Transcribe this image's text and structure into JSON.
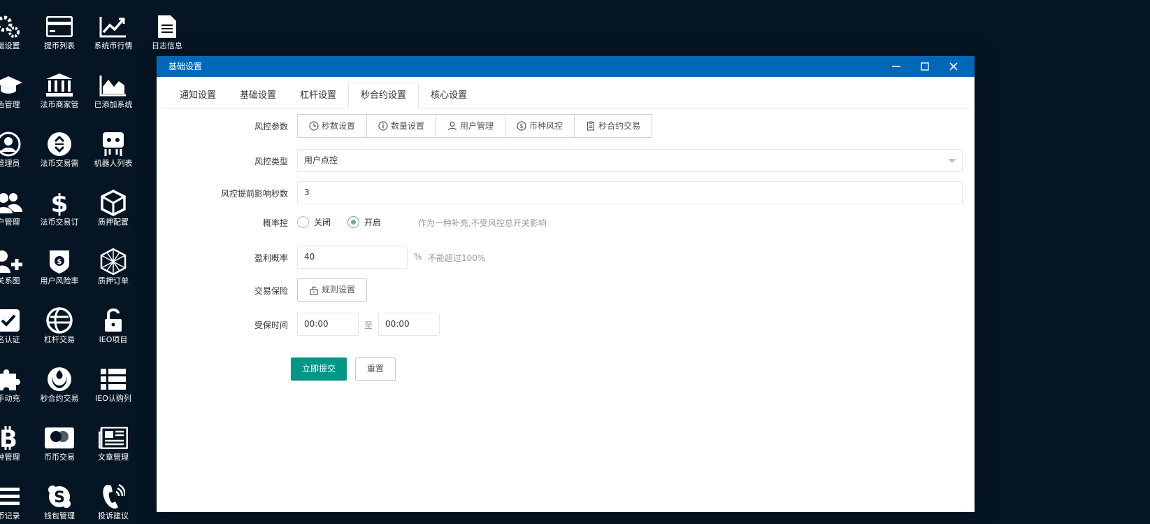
{
  "desktop": {
    "icons": [
      {
        "label": "础设置",
        "icon": "gears-icon"
      },
      {
        "label": "提币列表",
        "icon": "credit-card-icon"
      },
      {
        "label": "系统币行情",
        "icon": "line-chart-icon"
      },
      {
        "label": "日志信息",
        "icon": "document-icon"
      },
      {
        "label": "色管理",
        "icon": "graduation-cap-icon"
      },
      {
        "label": "法币商家管",
        "icon": "bank-icon"
      },
      {
        "label": "已添加系统",
        "icon": "area-chart-icon"
      },
      {
        "label": "管理员",
        "icon": "user-circle-icon"
      },
      {
        "label": "法币交易需",
        "icon": "exchange-icon"
      },
      {
        "label": "机器人列表",
        "icon": "robot-icon"
      },
      {
        "label": "户管理",
        "icon": "users-icon"
      },
      {
        "label": "法币交易订",
        "icon": "dollar-icon"
      },
      {
        "label": "质押配置",
        "icon": "cube-icon"
      },
      {
        "label": "关系图",
        "icon": "user-plus-icon"
      },
      {
        "label": "用户风险率",
        "icon": "shield-coin-icon"
      },
      {
        "label": "质押订单",
        "icon": "polyhedron-icon"
      },
      {
        "label": "名认证",
        "icon": "check-square-icon"
      },
      {
        "label": "杠杆交易",
        "icon": "globe-icon"
      },
      {
        "label": "IEO项目",
        "icon": "unlock-icon"
      },
      {
        "label": "手动充",
        "icon": "puzzle-icon"
      },
      {
        "label": "秒合约交易",
        "icon": "rebel-icon"
      },
      {
        "label": "IEO认购列",
        "icon": "list-icon"
      },
      {
        "label": "种管理",
        "icon": "bitcoin-icon"
      },
      {
        "label": "币币交易",
        "icon": "mastercard-icon"
      },
      {
        "label": "文章管理",
        "icon": "newspaper-icon"
      },
      {
        "label": "币记录",
        "icon": "bars-icon"
      },
      {
        "label": "钱包管理",
        "icon": "skype-icon"
      },
      {
        "label": "投诉建议",
        "icon": "phone-volume-icon"
      }
    ]
  },
  "window": {
    "title": "基础设置",
    "tabs": [
      {
        "label": "通知设置",
        "active": false
      },
      {
        "label": "基础设置",
        "active": false
      },
      {
        "label": "杠杆设置",
        "active": false
      },
      {
        "label": "秒合约设置",
        "active": true
      },
      {
        "label": "核心设置",
        "active": false
      }
    ]
  },
  "form": {
    "risk_params": {
      "label": "风控参数",
      "buttons": [
        {
          "label": "秒数设置",
          "icon": "clock-icon"
        },
        {
          "label": "数量设置",
          "icon": "info-icon"
        },
        {
          "label": "用户管理",
          "icon": "user-icon"
        },
        {
          "label": "币种风控",
          "icon": "dollar-circle-icon"
        },
        {
          "label": "秒合约交易",
          "icon": "clipboard-icon"
        }
      ]
    },
    "risk_type": {
      "label": "风控类型",
      "value": "用户点控"
    },
    "advance_seconds": {
      "label": "风控提前影响秒数",
      "value": "3"
    },
    "probability": {
      "label": "概率控",
      "options": [
        {
          "label": "关闭",
          "checked": false
        },
        {
          "label": "开启",
          "checked": true
        }
      ],
      "hint": "作为一种补充,不受风控总开关影响"
    },
    "profit_rate": {
      "label": "盈利概率",
      "value": "40",
      "unit": "%",
      "hint": "不能超过100%"
    },
    "insurance": {
      "label": "交易保险",
      "button": "规则设置"
    },
    "insured_time": {
      "label": "受保时间",
      "from": "00:00",
      "sep": "至",
      "to": "00:00"
    },
    "submit": "立即提交",
    "reset": "重置"
  },
  "colors": {
    "desktop_bg": "#061523",
    "title_bar": "#0068b7",
    "primary": "#009688",
    "radio_on": "#5fb878"
  }
}
